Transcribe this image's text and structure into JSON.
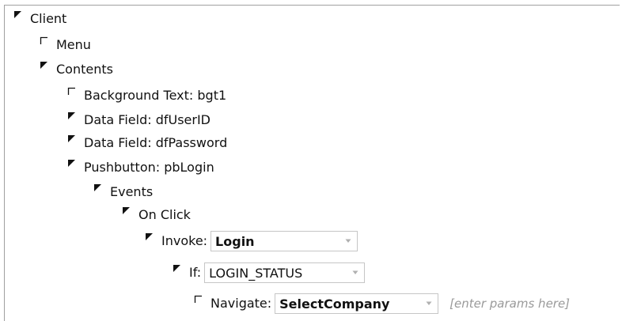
{
  "tree": {
    "client": {
      "label": "Client",
      "expanded": true
    },
    "menu": {
      "label": "Menu",
      "expanded": false
    },
    "contents": {
      "label": "Contents",
      "expanded": true
    },
    "background_text": {
      "label": "Background Text: bgt1",
      "expanded": false
    },
    "data_field_user": {
      "label": "Data Field: dfUserID",
      "expanded": true
    },
    "data_field_password": {
      "label": "Data Field: dfPassword",
      "expanded": true
    },
    "pushbutton": {
      "label": "Pushbutton: pbLogin",
      "expanded": true
    },
    "events": {
      "label": "Events",
      "expanded": true
    },
    "on_click": {
      "label": "On Click",
      "expanded": true
    },
    "invoke": {
      "label": "Invoke:",
      "value": "Login",
      "expanded": true
    },
    "if_node": {
      "label": "If:",
      "value": "LOGIN_STATUS",
      "expanded": true
    },
    "navigate": {
      "label": "Navigate:",
      "value": "SelectCompany",
      "params_placeholder": "[enter params here]",
      "expanded": false
    }
  },
  "icons": {
    "expanded": "expanded-triangle-icon",
    "collapsed": "collapsed-corner-icon",
    "dropdown": "dropdown-arrow-icon"
  },
  "colors": {
    "border": "#a0a0a0",
    "combo_border": "#c6c6c6",
    "placeholder": "#9a9a9a",
    "arrow": "#b0b0b0"
  }
}
